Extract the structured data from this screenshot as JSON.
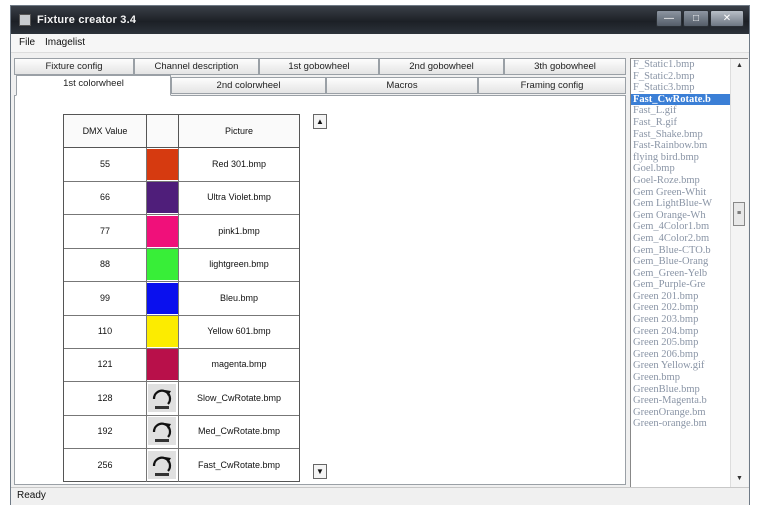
{
  "window": {
    "title": "Fixture creator 3.4",
    "controls": {
      "minimize": "—",
      "maximize": "□",
      "close": "✕"
    }
  },
  "menu": [
    "File",
    "Imagelist"
  ],
  "tabs": {
    "row1": [
      "Fixture config",
      "Channel description",
      "1st gobowheel",
      "2nd gobowheel",
      "3th gobowheel"
    ],
    "row2": [
      "1st colorwheel",
      "2nd colorwheel",
      "Macros",
      "Framing config"
    ],
    "active": "1st colorwheel"
  },
  "grid": {
    "headers": [
      "DMX Value",
      "",
      "Picture"
    ],
    "rows": [
      {
        "dmx": "55",
        "color": "#d63a10",
        "picture": "Red 301.bmp"
      },
      {
        "dmx": "66",
        "color": "#4f1e7a",
        "picture": "Ultra Violet.bmp"
      },
      {
        "dmx": "77",
        "color": "#f0107a",
        "picture": "pink1.bmp"
      },
      {
        "dmx": "88",
        "color": "#38ee38",
        "picture": "lightgreen.bmp"
      },
      {
        "dmx": "99",
        "color": "#0a10ee",
        "picture": "Bleu.bmp"
      },
      {
        "dmx": "110",
        "color": "#fcec00",
        "picture": "Yellow 601.bmp"
      },
      {
        "dmx": "121",
        "color": "#b8104a",
        "picture": "magenta.bmp"
      },
      {
        "dmx": "128",
        "icon": "slow-rotate-icon",
        "picture": "Slow_CwRotate.bmp"
      },
      {
        "dmx": "192",
        "icon": "med-rotate-icon",
        "picture": "Med_CwRotate.bmp"
      },
      {
        "dmx": "256",
        "icon": "fast-rotate-icon",
        "picture": "Fast_CwRotate.bmp"
      }
    ]
  },
  "scroll": {
    "up": "▲",
    "down": "▼"
  },
  "imagelist": {
    "items": [
      "F_Static1.bmp",
      "F_Static2.bmp",
      "F_Static3.bmp",
      "Fast_CwRotate.b",
      "Fast_L.gif",
      "Fast_R.gif",
      "Fast_Shake.bmp",
      "Fast-Rainbow.bm",
      "flying bird.bmp",
      "Goel.bmp",
      "Goel-Roze.bmp",
      "Gem Green-Whit",
      "Gem LightBlue-W",
      "Gem Orange-Wh",
      "Gem_4Color1.bm",
      "Gem_4Color2.bm",
      "Gem_Blue-CTO.b",
      "Gem_Blue-Orang",
      "Gem_Green-Yelb",
      "Gem_Purple-Gre",
      "Green 201.bmp",
      "Green 202.bmp",
      "Green 203.bmp",
      "Green 204.bmp",
      "Green 205.bmp",
      "Green 206.bmp",
      "Green Yellow.gif",
      "Green.bmp",
      "GreenBlue.bmp",
      "Green-Magenta.b",
      "GreenOrange.bm",
      "Green-orange.bm"
    ],
    "selected_index": 3,
    "scroll_up": "▲",
    "scroll_down": "▼",
    "thumb": "≡"
  },
  "status": "Ready"
}
